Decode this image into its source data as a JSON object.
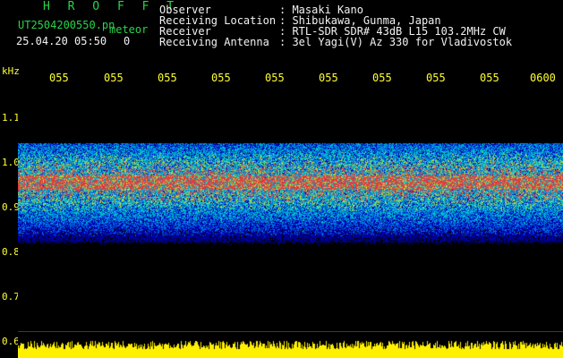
{
  "header": {
    "logo": "H R O F F T",
    "filename": "UT2504200550.pn",
    "meteor_label": "meteor",
    "datetime": "25.04.20 05:50",
    "meteor_count": "0",
    "fields": [
      {
        "label": "Observer",
        "value": ": Masaki Kano"
      },
      {
        "label": "Receiving Location",
        "value": ": Shibukawa, Gunma, Japan"
      },
      {
        "label": "Receiver",
        "value": ": RTL-SDR SDR# 43dB L15 103.2MHz CW"
      },
      {
        "label": "Receiving Antenna",
        "value": ": 3el Yagi(V) Az 330 for Vladivostok"
      }
    ]
  },
  "y_axis": {
    "unit": "kHz",
    "ticks": [
      "1.1",
      "1.0",
      "0.9",
      "0.8",
      "0.7",
      "0.6"
    ]
  },
  "x_axis": {
    "ticks": [
      "055",
      "055",
      "055",
      "055",
      "055",
      "055",
      "055",
      "055",
      "055",
      "0600"
    ]
  },
  "colors": {
    "background": "#000000",
    "text_green": "#29d34a",
    "text_white": "#f2f2f2",
    "text_yellow": "#ffff33"
  }
}
